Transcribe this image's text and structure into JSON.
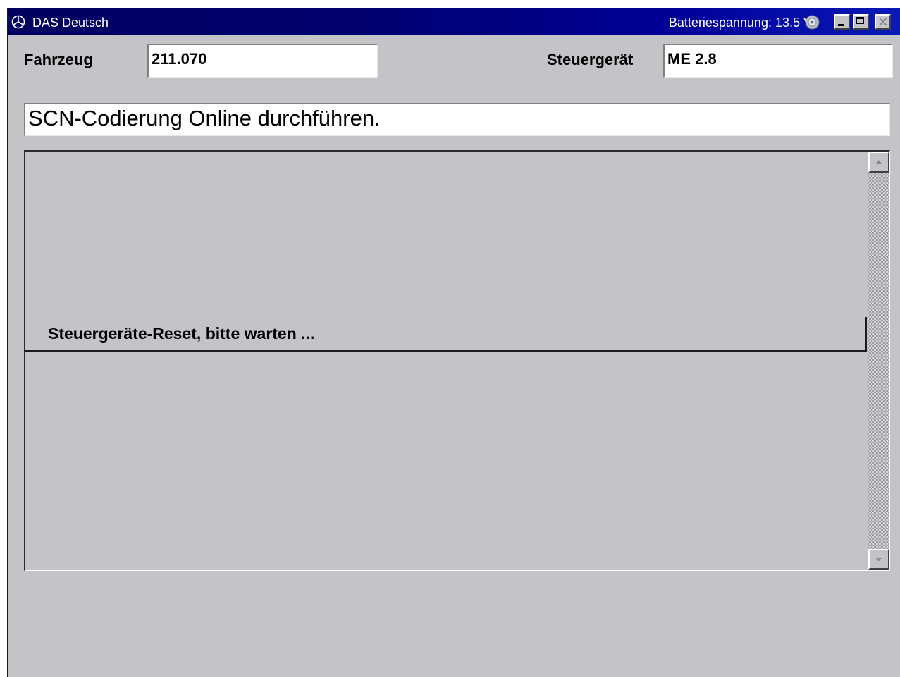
{
  "window": {
    "title": "DAS Deutsch",
    "battery_text": "Batteriespannung: 13.5 V"
  },
  "header": {
    "vehicle_label": "Fahrzeug",
    "vehicle_value": "211.070",
    "ecu_label": "Steuergerät",
    "ecu_value": "ME 2.8"
  },
  "instruction": "SCN-Codierung Online durchführen.",
  "status_message": "Steuergeräte-Reset, bitte warten ..."
}
